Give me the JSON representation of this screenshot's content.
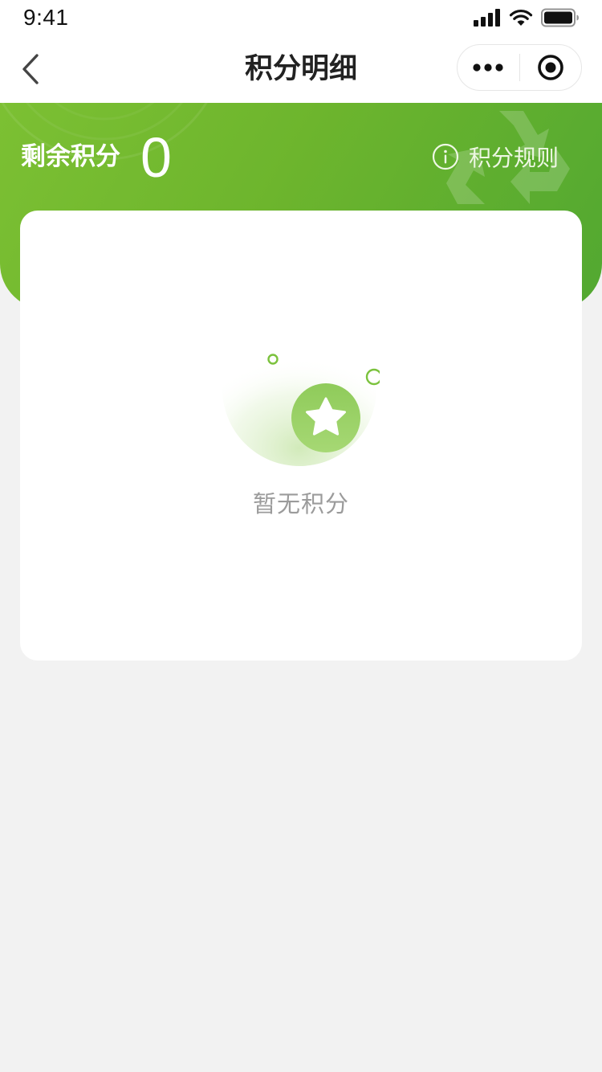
{
  "status_bar": {
    "time": "9:41"
  },
  "nav": {
    "title": "积分明细",
    "back_icon": "chevron-left-icon",
    "more_icon": "more-dots-icon",
    "close_icon": "target-circle-icon"
  },
  "header": {
    "points_label": "剩余积分",
    "points_value": "0",
    "rules_label": "积分规则",
    "rules_icon": "info-circle-icon",
    "watermark_icon": "recycle-icon",
    "gradient_start": "#7cc033",
    "gradient_end": "#52a831"
  },
  "empty_state": {
    "icon": "star-icon",
    "message": "暂无积分",
    "accent": "#7bc23d"
  },
  "colors": {
    "page_background": "#f2f2f2",
    "card_background": "#ffffff",
    "muted_text": "#9b9b9b"
  }
}
